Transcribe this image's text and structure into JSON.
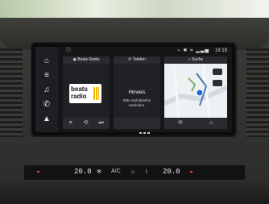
{
  "screen": {
    "status": {
      "info_icon": "info-icon",
      "time": "16:19",
      "icons": [
        "antenna-icon",
        "bluetooth-icon",
        "network-icon",
        "signal-icon"
      ]
    },
    "rail": {
      "items": [
        {
          "icon": "home-icon",
          "symbol": "⌂"
        },
        {
          "icon": "equalizer-icon",
          "symbol": "≡"
        },
        {
          "icon": "music-note-icon",
          "symbol": "♫"
        },
        {
          "icon": "phone-icon",
          "symbol": "✆"
        },
        {
          "icon": "navigation-icon",
          "symbol": "▲"
        }
      ]
    },
    "tiles": {
      "radio": {
        "header": "Beats Radio",
        "logo_text_line1": "beats",
        "logo_text_line2": "radio",
        "controls": [
          "≡",
          "⟲",
          "⏭"
        ]
      },
      "phone": {
        "header": "Telefon",
        "title": "Hinweis",
        "body": "Bitte Mobiltelefon verbinden."
      },
      "search": {
        "header": "Suche",
        "controls": [
          "⟲",
          "⌂"
        ]
      }
    }
  },
  "climate": {
    "left_temp": "20.0",
    "right_temp": "20.0",
    "center_label": "A/C"
  }
}
